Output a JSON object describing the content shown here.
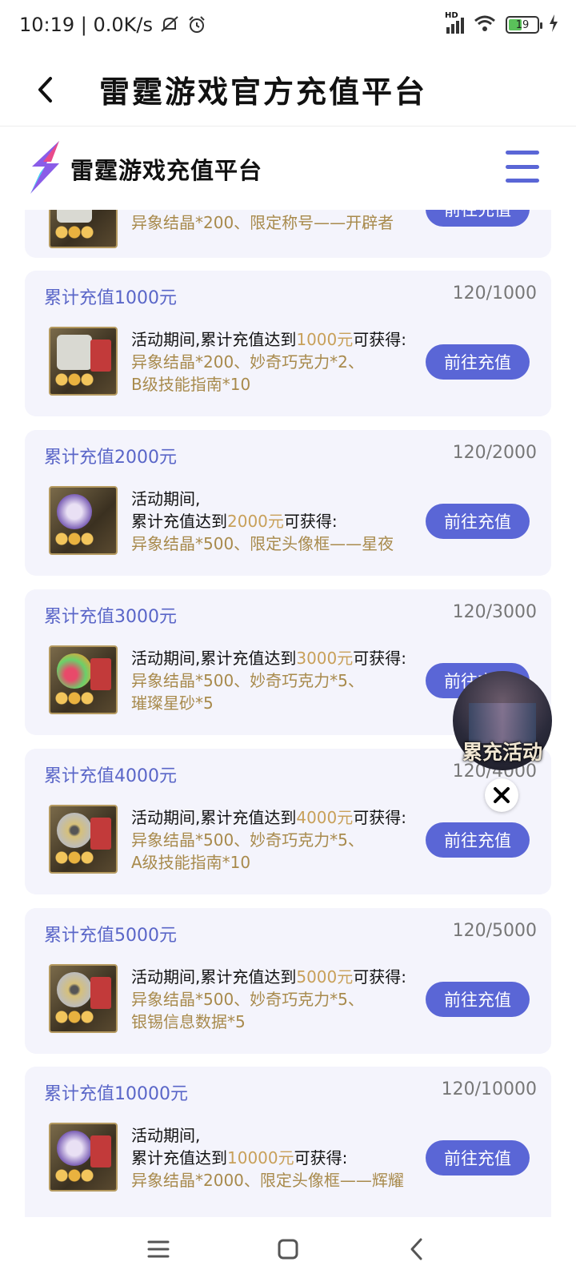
{
  "status_bar": {
    "time_speed": "10:19 | 0.0K/s",
    "network_label": "HD",
    "battery_level": "19"
  },
  "title_bar": {
    "title": "雷霆游戏官方充值平台"
  },
  "site_header": {
    "name": "雷霆游戏充值平台"
  },
  "partial_card": {
    "reward": "异象结晶*200、限定称号——开辟者",
    "button": "前往充值"
  },
  "cards": [
    {
      "heading": "累计充值1000元",
      "progress": "120/1000",
      "line1_pre": "活动期间,累计充值达到",
      "amount": "1000元",
      "line1_post": "可获得:",
      "reward1": "异象结晶*200、妙奇巧克力*2、",
      "reward2": "B级技能指南*10",
      "button": "前往充值"
    },
    {
      "heading": "累计充值2000元",
      "progress": "120/2000",
      "line0": "活动期间,",
      "line1_pre": "累计充值达到",
      "amount": "2000元",
      "line1_post": "可获得:",
      "reward1": "异象结晶*500、限定头像框——星夜",
      "button": "前往充值"
    },
    {
      "heading": "累计充值3000元",
      "progress": "120/3000",
      "line1_pre": "活动期间,累计充值达到",
      "amount": "3000元",
      "line1_post": "可获得:",
      "reward1": "异象结晶*500、妙奇巧克力*5、",
      "reward2": "璀璨星砂*5",
      "button": "前往充值"
    },
    {
      "heading": "累计充值4000元",
      "progress": "120/4000",
      "line1_pre": "活动期间,累计充值达到",
      "amount": "4000元",
      "line1_post": "可获得:",
      "reward1": "异象结晶*500、妙奇巧克力*5、",
      "reward2": "A级技能指南*10",
      "button": "前往充值"
    },
    {
      "heading": "累计充值5000元",
      "progress": "120/5000",
      "line1_pre": "活动期间,累计充值达到",
      "amount": "5000元",
      "line1_post": "可获得:",
      "reward1": "异象结晶*500、妙奇巧克力*5、",
      "reward2": "银锡信息数据*5",
      "button": "前往充值"
    },
    {
      "heading": "累计充值10000元",
      "progress": "120/10000",
      "line0": "活动期间,",
      "line1_pre": "累计充值达到",
      "amount": "10000元",
      "line1_post": "可获得:",
      "reward1": "异象结晶*2000、限定头像框——辉耀",
      "button": "前往充值"
    }
  ],
  "promo": {
    "label": "累充活动"
  },
  "colors": {
    "accent": "#5a66d6",
    "heading": "#5a66c8",
    "reward": "#a88a4c",
    "card_bg": "#f4f4fc"
  }
}
